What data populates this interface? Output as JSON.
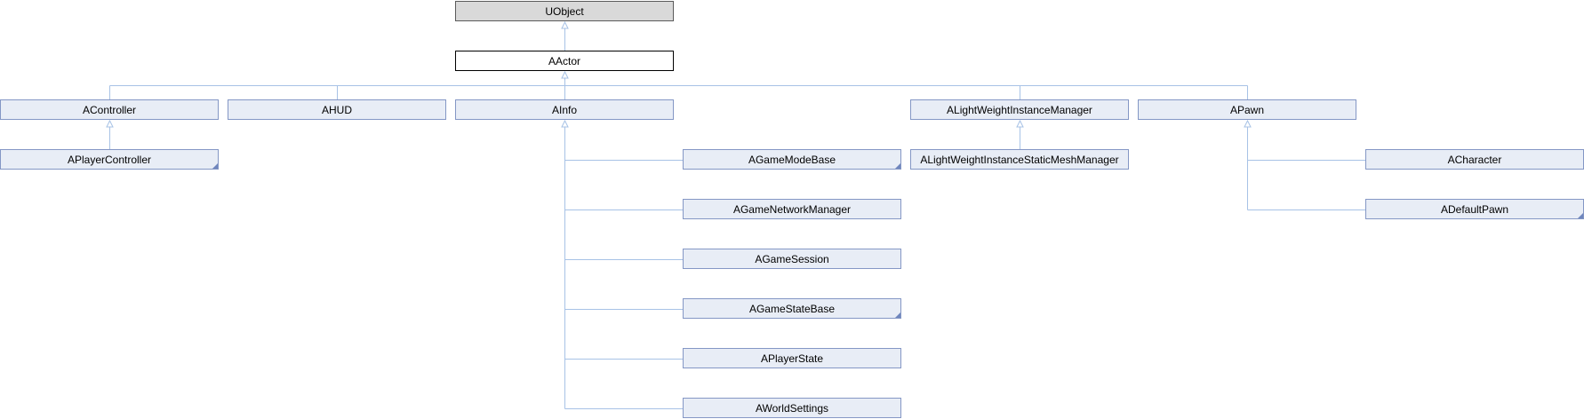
{
  "colors": {
    "edge": "#a7c2e6",
    "node_fill": "#e8edf6",
    "node_border": "#8497c5",
    "root_fill": "#d9d9d9",
    "current_fill": "#ffffff"
  },
  "diagram": {
    "nodes": {
      "uobject": {
        "label": "UObject",
        "kind": "root"
      },
      "aactor": {
        "label": "AActor",
        "kind": "current"
      },
      "acontroller": {
        "label": "AController",
        "kind": "default"
      },
      "ahud": {
        "label": "AHUD",
        "kind": "default"
      },
      "ainfo": {
        "label": "AInfo",
        "kind": "default"
      },
      "alightweightinstancemanager": {
        "label": "ALightWeightInstanceManager",
        "kind": "default"
      },
      "apawn": {
        "label": "APawn",
        "kind": "default"
      },
      "aplayercontroller": {
        "label": "APlayerController",
        "kind": "default",
        "has_more": true
      },
      "agamemodebase": {
        "label": "AGameModeBase",
        "kind": "default",
        "has_more": true
      },
      "agamenetworkmanager": {
        "label": "AGameNetworkManager",
        "kind": "default"
      },
      "agamesession": {
        "label": "AGameSession",
        "kind": "default"
      },
      "agamestatebase": {
        "label": "AGameStateBase",
        "kind": "default",
        "has_more": true
      },
      "aplayerstate": {
        "label": "APlayerState",
        "kind": "default"
      },
      "aworldsettings": {
        "label": "AWorldSettings",
        "kind": "default"
      },
      "alightweightinstancestaticmeshmanager": {
        "label": "ALightWeightInstanceStaticMeshManager",
        "kind": "default"
      },
      "acharacter": {
        "label": "ACharacter",
        "kind": "default"
      },
      "adefaultpawn": {
        "label": "ADefaultPawn",
        "kind": "default",
        "has_more": true
      }
    },
    "edges": [
      [
        "aactor",
        "uobject"
      ],
      [
        "acontroller",
        "aactor"
      ],
      [
        "ahud",
        "aactor"
      ],
      [
        "ainfo",
        "aactor"
      ],
      [
        "alightweightinstancemanager",
        "aactor"
      ],
      [
        "apawn",
        "aactor"
      ],
      [
        "aplayercontroller",
        "acontroller"
      ],
      [
        "agamemodebase",
        "ainfo"
      ],
      [
        "agamenetworkmanager",
        "ainfo"
      ],
      [
        "agamesession",
        "ainfo"
      ],
      [
        "agamestatebase",
        "ainfo"
      ],
      [
        "aplayerstate",
        "ainfo"
      ],
      [
        "aworldsettings",
        "ainfo"
      ],
      [
        "alightweightinstancestaticmeshmanager",
        "alightweightinstancemanager"
      ],
      [
        "acharacter",
        "apawn"
      ],
      [
        "adefaultpawn",
        "apawn"
      ]
    ]
  }
}
